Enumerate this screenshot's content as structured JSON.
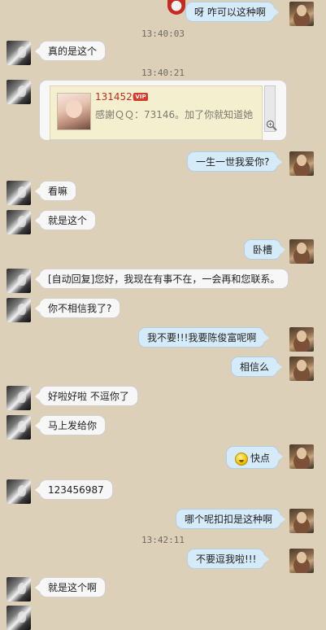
{
  "timestamps": [
    "13:40:03",
    "13:40:21",
    "13:42:11"
  ],
  "shared_card": {
    "name": "1314520",
    "badge": "VIP",
    "text": "感謝ＱＱ：73146。加了你就知道她"
  },
  "messages": [
    {
      "side": "right",
      "text": "呀  咋可以这种啊"
    },
    {
      "side": "left",
      "text": "真的是这个"
    },
    {
      "side": "right",
      "text": "一生一世我爱你?"
    },
    {
      "side": "left",
      "text": "看嘛"
    },
    {
      "side": "left",
      "text": "就是这个"
    },
    {
      "side": "right",
      "text": "卧槽"
    },
    {
      "side": "left",
      "text": "[自动回复]您好，我现在有事不在，一会再和您联系。"
    },
    {
      "side": "left",
      "text": "你不相信我了?"
    },
    {
      "side": "right",
      "text": "我不要!!!我要陈俊富呢啊"
    },
    {
      "side": "right",
      "text": "相信么"
    },
    {
      "side": "left",
      "text": "好啦好啦 不逗你了"
    },
    {
      "side": "left",
      "text": "马上发给你"
    },
    {
      "side": "right",
      "text": "快点",
      "emoji": "smiley-face"
    },
    {
      "side": "left",
      "text": "123456987"
    },
    {
      "side": "right",
      "text": "哪个呢扣扣是这种啊"
    },
    {
      "side": "right",
      "text": "不要逗我啦!!!"
    },
    {
      "side": "left",
      "text": "就是这个啊"
    }
  ]
}
